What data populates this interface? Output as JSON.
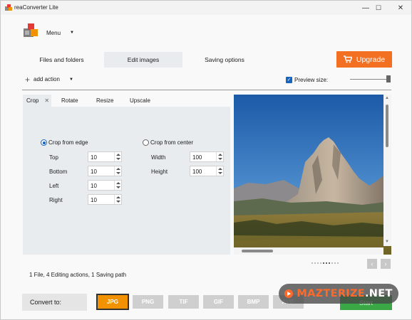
{
  "window": {
    "title": "reaConverter Lite",
    "controls": {
      "minimize": "—",
      "maximize": "☐",
      "close": "✕"
    }
  },
  "header": {
    "menu_label": "Menu"
  },
  "main_tabs": [
    {
      "label": "Files and folders",
      "active": false
    },
    {
      "label": "Edit images",
      "active": true
    },
    {
      "label": "Saving options",
      "active": false
    }
  ],
  "upgrade": {
    "label": "Upgrade",
    "icon": "cart-icon",
    "color": "#f36f21"
  },
  "toolbar": {
    "add_action_label": "add action",
    "preview_size_label": "Preview size:",
    "preview_size_checked": true,
    "preview_size_level": 1.0
  },
  "edit_tabs": [
    {
      "label": "Crop",
      "active": true,
      "closable": true
    },
    {
      "label": "Rotate",
      "active": false
    },
    {
      "label": "Resize",
      "active": false
    },
    {
      "label": "Upscale",
      "active": false
    }
  ],
  "crop": {
    "mode_edge_label": "Crop from edge",
    "mode_center_label": "Crop from center",
    "selected_mode": "edge",
    "edge_fields": [
      {
        "label": "Top",
        "value": "10"
      },
      {
        "label": "Bottom",
        "value": "10"
      },
      {
        "label": "Left",
        "value": "10"
      },
      {
        "label": "Right",
        "value": "10"
      }
    ],
    "center_fields": [
      {
        "label": "Width",
        "value": "100"
      },
      {
        "label": "Height",
        "value": "100"
      }
    ]
  },
  "status": "1 File, 4 Editing actions, 1 Saving path",
  "convert": {
    "label": "Convert to:",
    "formats": [
      {
        "label": "JPG",
        "active": true
      },
      {
        "label": "PNG",
        "active": false
      },
      {
        "label": "TIF",
        "active": false
      },
      {
        "label": "GIF",
        "active": false
      },
      {
        "label": "BMP",
        "active": false
      },
      {
        "label": "AVIF",
        "active": false
      }
    ],
    "start_label": "Start"
  },
  "watermark": {
    "text": "MAZTERIZE",
    "suffix": ".NET"
  },
  "colors": {
    "accent": "#1565c0",
    "orange": "#f39200",
    "green": "#3aa845"
  }
}
